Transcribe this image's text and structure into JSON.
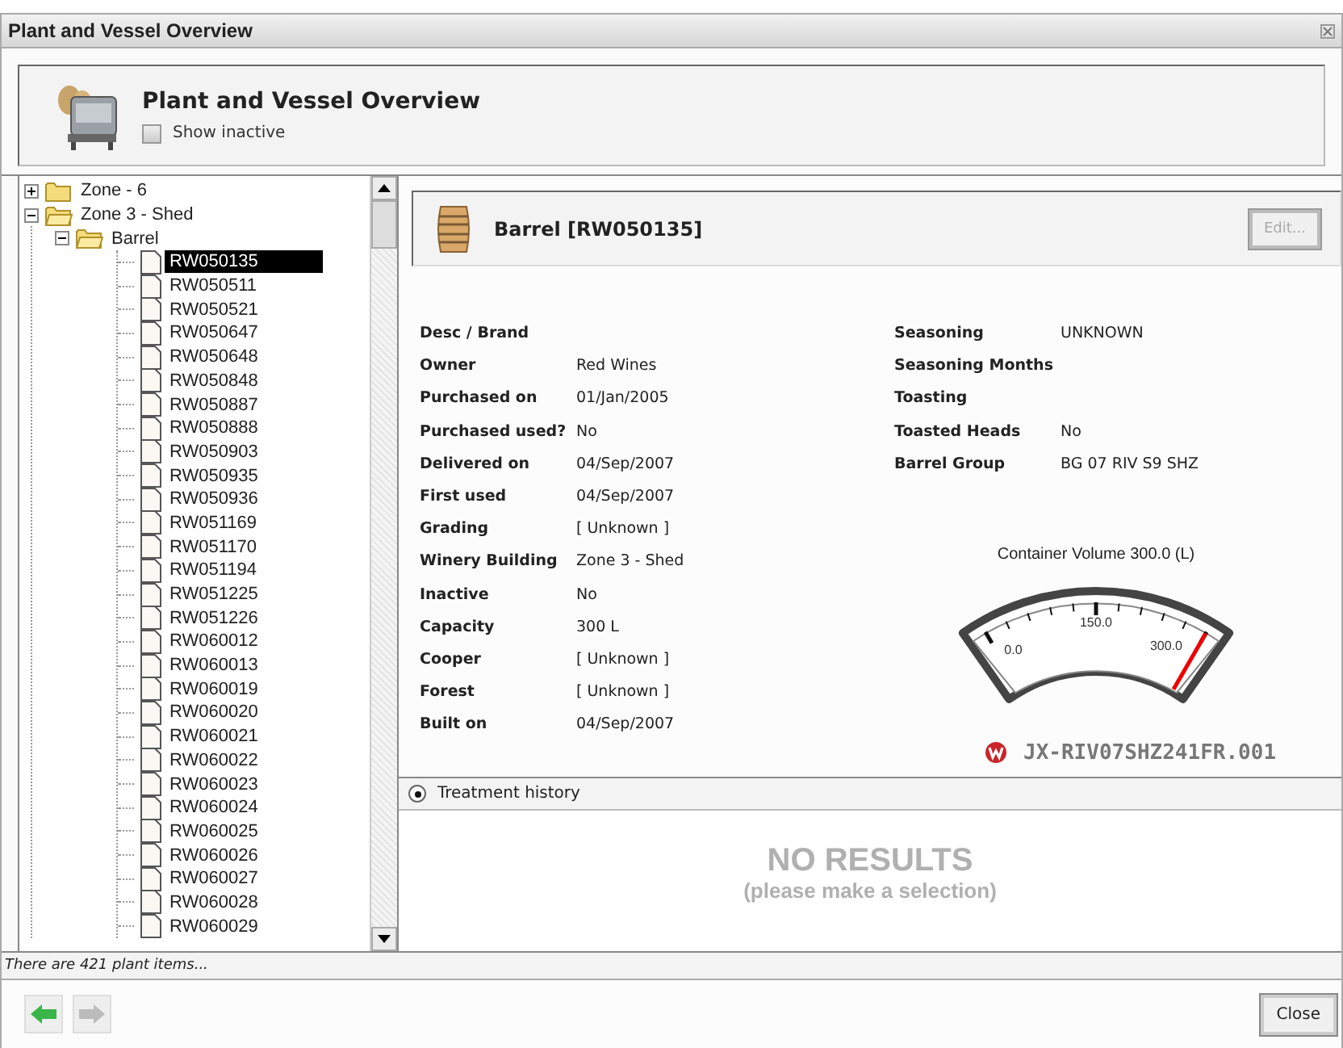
{
  "window": {
    "title": "Plant and Vessel Overview"
  },
  "header": {
    "title": "Plant and Vessel Overview",
    "show_inactive": {
      "label": "Show inactive",
      "checked": false
    }
  },
  "tree": [
    {
      "label": "Zone - 6",
      "kind": "folder",
      "expanded": false,
      "selected": false
    },
    {
      "label": "Zone 3 - Shed",
      "kind": "folder",
      "expanded": true,
      "selected": false,
      "children": [
        {
          "label": "Barrel",
          "kind": "folder",
          "expanded": true,
          "selected": false,
          "children": [
            {
              "label": "RW050135",
              "kind": "item",
              "selected": true
            },
            {
              "label": "RW050511",
              "kind": "item",
              "selected": false
            },
            {
              "label": "RW050521",
              "kind": "item",
              "selected": false
            },
            {
              "label": "RW050647",
              "kind": "item",
              "selected": false
            },
            {
              "label": "RW050648",
              "kind": "item",
              "selected": false
            },
            {
              "label": "RW050848",
              "kind": "item",
              "selected": false
            },
            {
              "label": "RW050887",
              "kind": "item",
              "selected": false
            },
            {
              "label": "RW050888",
              "kind": "item",
              "selected": false
            },
            {
              "label": "RW050903",
              "kind": "item",
              "selected": false
            },
            {
              "label": "RW050935",
              "kind": "item",
              "selected": false
            },
            {
              "label": "RW050936",
              "kind": "item",
              "selected": false
            },
            {
              "label": "RW051169",
              "kind": "item",
              "selected": false
            },
            {
              "label": "RW051170",
              "kind": "item",
              "selected": false
            },
            {
              "label": "RW051194",
              "kind": "item",
              "selected": false
            },
            {
              "label": "RW051225",
              "kind": "item",
              "selected": false
            },
            {
              "label": "RW051226",
              "kind": "item",
              "selected": false
            },
            {
              "label": "RW060012",
              "kind": "item",
              "selected": false
            },
            {
              "label": "RW060013",
              "kind": "item",
              "selected": false
            },
            {
              "label": "RW060019",
              "kind": "item",
              "selected": false
            },
            {
              "label": "RW060020",
              "kind": "item",
              "selected": false
            },
            {
              "label": "RW060021",
              "kind": "item",
              "selected": false
            },
            {
              "label": "RW060022",
              "kind": "item",
              "selected": false
            },
            {
              "label": "RW060023",
              "kind": "item",
              "selected": false
            },
            {
              "label": "RW060024",
              "kind": "item",
              "selected": false
            },
            {
              "label": "RW060025",
              "kind": "item",
              "selected": false
            },
            {
              "label": "RW060026",
              "kind": "item",
              "selected": false
            },
            {
              "label": "RW060027",
              "kind": "item",
              "selected": false
            },
            {
              "label": "RW060028",
              "kind": "item",
              "selected": false
            },
            {
              "label": "RW060029",
              "kind": "item",
              "selected": false
            }
          ]
        }
      ]
    }
  ],
  "detail": {
    "title": "Barrel [RW050135]",
    "edit_button": {
      "label": "Edit...",
      "disabled": true
    },
    "left_fields": [
      {
        "label": "Desc / Brand"
      },
      {
        "label": "Owner",
        "value": "Red Wines"
      },
      {
        "label": "Purchased on",
        "value": "01/Jan/2005"
      },
      {
        "label": "Purchased used?",
        "value": "No"
      },
      {
        "label": "Delivered on",
        "value": "04/Sep/2007"
      },
      {
        "label": "First used",
        "value": "04/Sep/2007"
      },
      {
        "label": "Grading",
        "value": "[ Unknown ]"
      },
      {
        "label": "Winery Building",
        "value": "Zone 3 - Shed"
      },
      {
        "label": "Inactive",
        "value": "No"
      },
      {
        "label": "Capacity",
        "value": "300 L"
      },
      {
        "label": "Cooper",
        "value": "[ Unknown ]"
      },
      {
        "label": "Forest",
        "value": "[ Unknown ]"
      },
      {
        "label": "Built on",
        "value": "04/Sep/2007"
      }
    ],
    "right_fields": [
      {
        "label": "Seasoning",
        "value": "UNKNOWN"
      },
      {
        "label": "Seasoning Months"
      },
      {
        "label": "Toasting"
      },
      {
        "label": "Toasted Heads",
        "value": "No"
      },
      {
        "label": "Barrel Group",
        "value": "BG 07 RIV S9 SHZ"
      }
    ],
    "gauge": {
      "title": "Container Volume 300.0 (L)",
      "level": 1,
      "scale_labels": [
        "0.0",
        "150.0",
        "300.0"
      ]
    },
    "code": "JX-RIV07SHZ241FR.001"
  },
  "treatment": {
    "label": "Treatment history",
    "selected": true
  },
  "results": {
    "title": "NO RESULTS",
    "hint": "(please make a selection)"
  },
  "status_bar": "There are 421 plant items...",
  "nav_buttons": [
    {
      "kind": "back",
      "disabled": false
    },
    {
      "kind": "forward",
      "disabled": true
    }
  ],
  "close_button": "Close"
}
